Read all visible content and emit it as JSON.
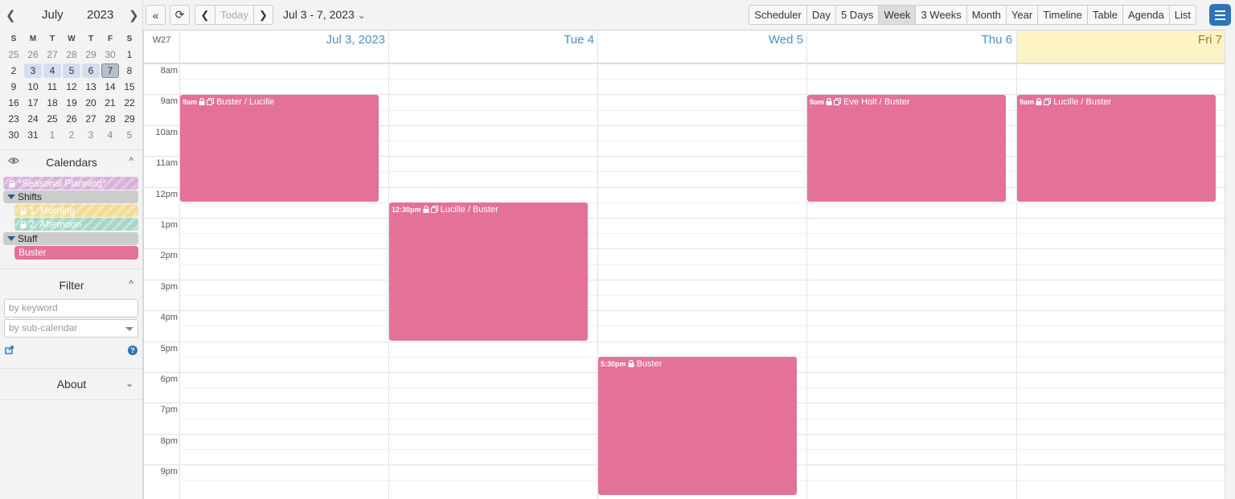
{
  "mini_calendar": {
    "month": "July",
    "year": "2023",
    "prev_icon": "chevron-left-icon",
    "next_icon": "chevron-right-icon",
    "weekdays": [
      "S",
      "M",
      "T",
      "W",
      "T",
      "F",
      "S"
    ],
    "weeks": [
      [
        "25",
        "26",
        "27",
        "28",
        "29",
        "30",
        "1"
      ],
      [
        "2",
        "3",
        "4",
        "5",
        "6",
        "7",
        "8"
      ],
      [
        "9",
        "10",
        "11",
        "12",
        "13",
        "14",
        "15"
      ],
      [
        "16",
        "17",
        "18",
        "19",
        "20",
        "21",
        "22"
      ],
      [
        "23",
        "24",
        "25",
        "26",
        "27",
        "28",
        "29"
      ],
      [
        "30",
        "31",
        "1",
        "2",
        "3",
        "4",
        "5"
      ]
    ]
  },
  "calendars": {
    "title": "Calendars",
    "eye_icon": "eye-icon",
    "items": {
      "seasonal": "*Seasonal Planning*",
      "shifts": "Shifts",
      "morning": "1. Morning",
      "afternoon": "2. Afternoon",
      "staff": "Staff",
      "buster": "Buster"
    }
  },
  "filter": {
    "title": "Filter",
    "keyword_placeholder": "by keyword",
    "subcalendar_placeholder": "by sub-calendar"
  },
  "about": {
    "title": "About"
  },
  "toolbar": {
    "today_label": "Today",
    "date_range": "Jul 3 - 7, 2023",
    "views": [
      "Scheduler",
      "Day",
      "5 Days",
      "Week",
      "3 Weeks",
      "Month",
      "Year",
      "Timeline",
      "Table",
      "Agenda",
      "List"
    ],
    "active_view": "Week"
  },
  "grid": {
    "week_label": "W27",
    "days": [
      "Jul 3, 2023",
      "Tue 4",
      "Wed 5",
      "Thu 6",
      "Fri 7"
    ],
    "hours": [
      "8am",
      "9am",
      "10am",
      "11am",
      "12pm",
      "1pm",
      "2pm",
      "3pm",
      "4pm",
      "5pm",
      "6pm",
      "7pm",
      "8pm",
      "9pm"
    ]
  },
  "events": [
    {
      "time": "9am",
      "title": "Buster / Lucille"
    },
    {
      "time": "12:30pm",
      "title": "Lucille / Buster"
    },
    {
      "time": "5:30pm",
      "title": "Buster"
    },
    {
      "time": "9am",
      "title": "Eve Holt / Buster"
    },
    {
      "time": "9am",
      "title": "Lucille / Buster"
    }
  ],
  "colors": {
    "event": "#e4719a",
    "accent": "#2f73b8",
    "today_bg": "#fdf3c5",
    "day_header_text": "#4a90c8"
  }
}
